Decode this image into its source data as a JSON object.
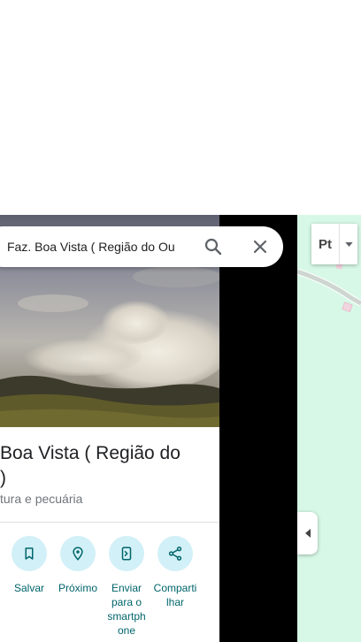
{
  "search": {
    "value": "Faz. Boa Vista ( Região do Our",
    "search_icon": "search-icon",
    "close_icon": "close-icon"
  },
  "place": {
    "title": "Boa Vista ( Região do\n)",
    "category": "tura e pecuária"
  },
  "actions": [
    {
      "label": "Salvar",
      "icon": "bookmark-icon"
    },
    {
      "label": "Próximo",
      "icon": "nearby-icon"
    },
    {
      "label": "Enviar\npara o\nsmartph\none",
      "icon": "send-to-phone-icon"
    },
    {
      "label": "Comparti\nlhar",
      "icon": "share-icon"
    }
  ],
  "map_controls": {
    "layer_abbr": "Pt",
    "collapse_icon": "chevron-left-icon",
    "dropdown_icon": "caret-down-icon"
  },
  "colors": {
    "accent_text": "#00656b",
    "action_circle": "#d2f0f7",
    "map_background": "#d7f8e6",
    "title_text": "#202124",
    "secondary_text": "#70757a"
  }
}
